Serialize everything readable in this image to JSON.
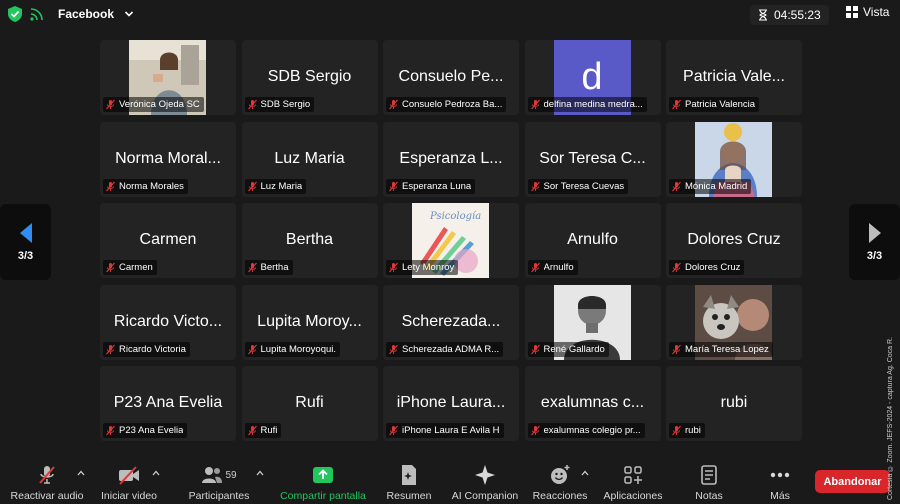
{
  "topbar": {
    "app_name": "Facebook",
    "timer": "04:55:23",
    "view_label": "Vista"
  },
  "pagination": {
    "left": "3/3",
    "right": "3/3"
  },
  "tiles": [
    {
      "display": "",
      "name": "Verónica Ojeda SC",
      "media": "photo-woman"
    },
    {
      "display": "SDB Sergio",
      "name": "SDB Sergio"
    },
    {
      "display": "Consuelo Pe...",
      "name": "Consuelo Pedroza Ba..."
    },
    {
      "display": "",
      "name": "delfina medina medra...",
      "media": "avatar-letter",
      "letter": "d"
    },
    {
      "display": "Patricia Vale...",
      "name": "Patricia Valencia"
    },
    {
      "display": "Norma Moral...",
      "name": "Norma Morales"
    },
    {
      "display": "Luz Maria",
      "name": "Luz Maria"
    },
    {
      "display": "Esperanza L...",
      "name": "Esperanza Luna"
    },
    {
      "display": "Sor Teresa C...",
      "name": "Sor Teresa Cuevas"
    },
    {
      "display": "",
      "name": "Mónica Madrid",
      "media": "photo-virgin"
    },
    {
      "display": "Carmen",
      "name": "Carmen"
    },
    {
      "display": "Bertha",
      "name": "Bertha"
    },
    {
      "display": "",
      "name": "Lety Monroy",
      "media": "photo-pencils"
    },
    {
      "display": "Arnulfo",
      "name": "Arnulfo"
    },
    {
      "display": "Dolores Cruz",
      "name": "Dolores Cruz"
    },
    {
      "display": "Ricardo Victo...",
      "name": "Ricardo Victoria"
    },
    {
      "display": "Lupita Moroy...",
      "name": "Lupita Moroyoqui."
    },
    {
      "display": "Scherezada...",
      "name": "Scherezada ADMA R..."
    },
    {
      "display": "",
      "name": "René Gallardo",
      "media": "photo-man"
    },
    {
      "display": "",
      "name": "María Teresa Lopez",
      "media": "photo-dog"
    },
    {
      "display": "P23 Ana Evelia",
      "name": "P23 Ana Evelia"
    },
    {
      "display": "Rufi",
      "name": "Rufi"
    },
    {
      "display": "iPhone Laura...",
      "name": "iPhone Laura E Avila H"
    },
    {
      "display": "exalumnas c...",
      "name": "exalumnas colegio pr..."
    },
    {
      "display": "rubi",
      "name": "rubi"
    }
  ],
  "toolbar": {
    "audio": "Reactivar audio",
    "video": "Iniciar video",
    "participants": "Participantes",
    "participants_count": "59",
    "share": "Compartir pantalla",
    "summary": "Resumen",
    "ai": "AI Companion",
    "reactions": "Reacciones",
    "apps": "Aplicaciones",
    "notes": "Notas",
    "more": "Más",
    "leave": "Abandonar"
  },
  "watermark": "Cortesía © Zoom. JEFS-2024 - captura Ag. Coca R.",
  "colors": {
    "accent_green": "#22c55e",
    "leave_red": "#d9262a",
    "mute_red": "#e0373b",
    "tile_bg": "#232323",
    "nav_blue": "#2e8ff0"
  }
}
